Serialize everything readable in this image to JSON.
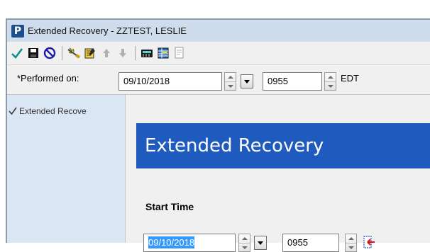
{
  "window": {
    "title": "Extended Recovery - ZZTEST, LESLIE",
    "app_icon_letter": "P"
  },
  "toolbar": {
    "buttons": [
      {
        "name": "sign-icon"
      },
      {
        "name": "save-icon"
      },
      {
        "name": "cancel-icon"
      },
      {
        "name": "modify-icon"
      },
      {
        "name": "note-icon"
      },
      {
        "name": "arrow-up-icon"
      },
      {
        "name": "arrow-down-icon"
      },
      {
        "name": "calculator-icon"
      },
      {
        "name": "flowsheet-icon"
      },
      {
        "name": "document-icon"
      }
    ]
  },
  "performed": {
    "label": "*Performed on:",
    "date": "09/10/2018",
    "time": "0955",
    "timezone": "EDT"
  },
  "sidebar": {
    "items": [
      {
        "label": "Extended Recove",
        "checked": true
      }
    ]
  },
  "main": {
    "banner_title": "Extended Recovery",
    "section_title": "Start Time",
    "start_date": "09/10/2018",
    "start_time": "0955"
  },
  "colors": {
    "banner": "#1f5bbf",
    "sidebar": "#dbe6f4",
    "selection": "#3399ff",
    "check": "#0e8f8f"
  }
}
